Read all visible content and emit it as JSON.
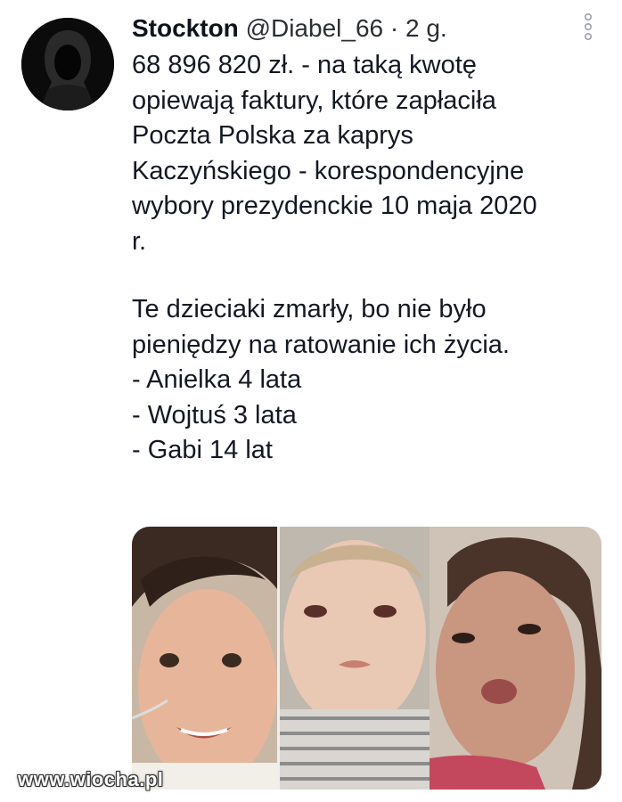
{
  "tweet": {
    "author_name": "Stockton",
    "handle": "@Diabel_66",
    "separator": "·",
    "time": "2 g.",
    "paragraph1": "68 896 820 zł. - na taką kwotę\nopiewają faktury, które zapłaciła\nPoczta Polska za kaprys\nKaczyńskiego - korespondencyjne\nwybory prezydenckie 10 maja 2020\nr.",
    "paragraph2_lines": [
      "Te dzieciaki zmarły, bo nie było",
      "pieniędzy na ratowanie ich życia.",
      "- Anielka 4 lata",
      "- Wojtuś 3 lata",
      "- Gabi 14 lat"
    ]
  },
  "icons": {
    "avatar": "hooded-figure-avatar",
    "more": "more-vertical-icon"
  },
  "colors": {
    "text": "#141823",
    "background": "#ffffff",
    "avatar_bg": "#0b0b0b"
  },
  "watermark": "www.wiocha.pl"
}
